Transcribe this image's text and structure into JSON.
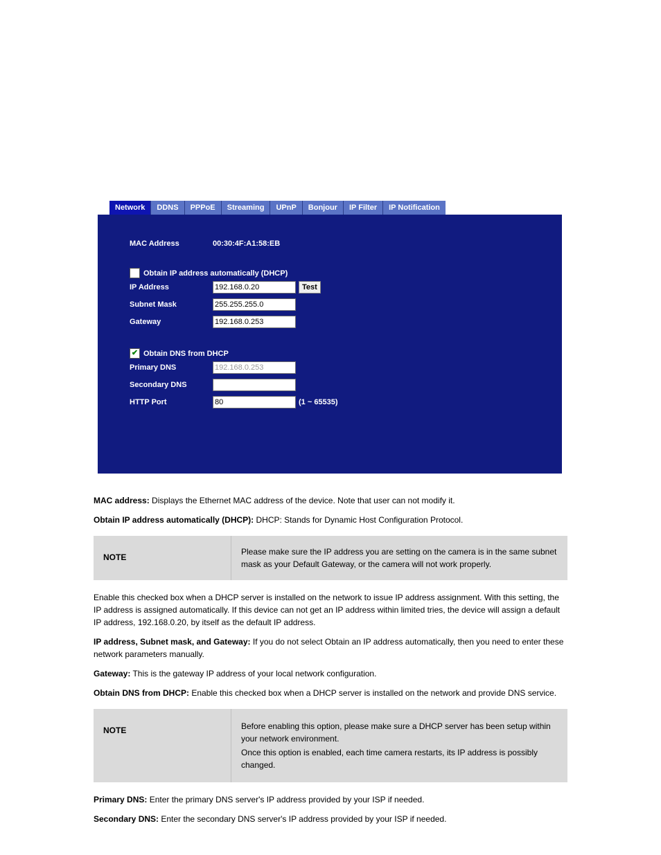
{
  "tabs": {
    "network": "Network",
    "ddns": "DDNS",
    "pppoe": "PPPoE",
    "streaming": "Streaming",
    "upnp": "UPnP",
    "bonjour": "Bonjour",
    "ipfilter": "IP Filter",
    "ipnotify": "IP Notification"
  },
  "panel": {
    "mac_label": "MAC Address",
    "mac_value": "00:30:4F:A1:58:EB",
    "dhcp_ip_label": "Obtain IP address automatically (DHCP)",
    "ip_label": "IP Address",
    "ip_value": "192.168.0.20",
    "test_btn": "Test",
    "subnet_label": "Subnet Mask",
    "subnet_value": "255.255.255.0",
    "gateway_label": "Gateway",
    "gateway_value": "192.168.0.253",
    "dhcp_dns_label": "Obtain DNS from DHCP",
    "pdns_label": "Primary DNS",
    "pdns_value": "192.168.0.253",
    "sdns_label": "Secondary DNS",
    "sdns_value": "",
    "http_label": "HTTP Port",
    "http_value": "80",
    "http_hint": "(1 ~ 65535)"
  },
  "doc": {
    "mac_term": "MAC address:",
    "mac_text": " Displays the Ethernet MAC address of the device. Note that user can not modify it.",
    "obtain_term": "Obtain IP address automatically (DHCP):",
    "obtain_text": " DHCP: Stands for Dynamic Host Configuration Protocol.",
    "obtain_p2": "Enable this checked box when a DHCP server is installed on the network to issue IP address assignment. With this setting, the IP address is assigned automatically. If this device can not get an IP address within limited tries, the device will assign a default IP address, 192.168.0.20, by itself as the default IP address.",
    "ip_term": "IP address, Subnet mask, and Gateway:",
    "ip_text": " If you do not select Obtain an IP address automatically, then you need to enter these network parameters manually.",
    "gw_term": "Gateway:",
    "gw_text": " This is the gateway IP address of your local network configuration.",
    "dns_term": "Obtain DNS from DHCP:",
    "dns_text": " Enable this checked box when a DHCP server is installed on the network and provide DNS service.",
    "pdns_term": "Primary DNS:",
    "pdns_text": " Enter the primary DNS server's IP address provided by your ISP if needed.",
    "sdns_term": "Secondary DNS:",
    "sdns_text": " Enter the secondary DNS server's IP address provided by your ISP if needed.",
    "note1_c1": "NOTE",
    "note1_c2": "Please make sure the IP address you are setting on the camera is in the same subnet mask as your Default Gateway, or the camera will not work properly.",
    "note2_c1": "NOTE",
    "note2_c2_l1": "Before enabling this option, please make sure a DHCP server has been setup within your network environment.",
    "note2_c2_l2": "Once this option is enabled, each time camera restarts, its IP address is possibly changed."
  }
}
